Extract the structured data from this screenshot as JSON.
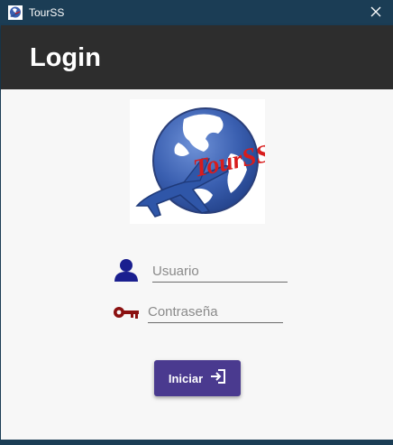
{
  "window": {
    "title": "TourSS",
    "app_icon": "globe-plane-icon",
    "close_icon": "close-icon"
  },
  "header": {
    "title": "Login"
  },
  "logo": {
    "icon": "globe-plane-logo",
    "text": "TourSS"
  },
  "form": {
    "username": {
      "icon": "user-icon",
      "placeholder": "Usuario",
      "value": ""
    },
    "password": {
      "icon": "key-icon",
      "placeholder": "Contraseña",
      "value": ""
    },
    "submit": {
      "label": "Iniciar",
      "icon": "login-arrow-icon"
    }
  },
  "colors": {
    "titlebar": "#1b3d55",
    "header": "#2d2d2d",
    "button": "#4a3a8f",
    "user_icon": "#1a1f8f",
    "key_icon": "#8b1010",
    "logo_globe": "#3a5fb0",
    "logo_text": "#d81c1c"
  }
}
